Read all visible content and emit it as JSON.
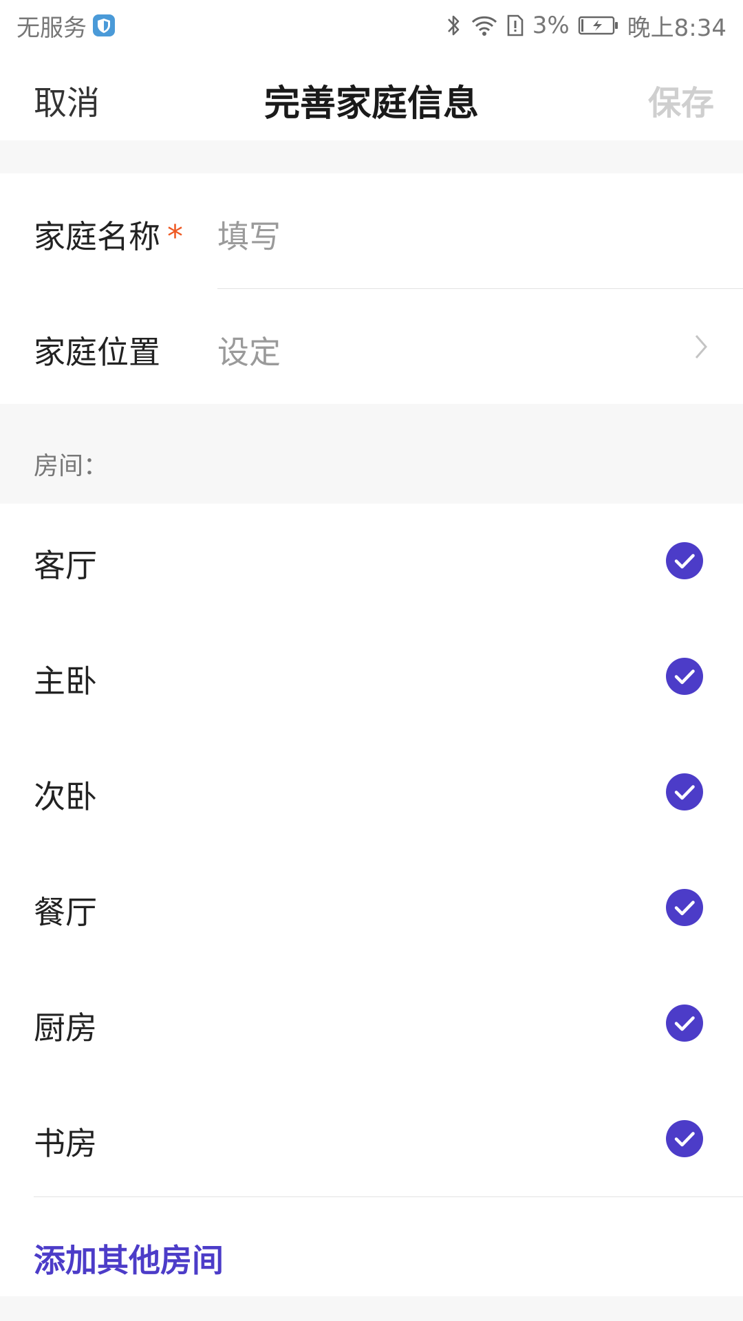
{
  "statusbar": {
    "carrier": "无服务",
    "battery_percent": "3%",
    "time": "晚上8:34"
  },
  "navbar": {
    "cancel": "取消",
    "title": "完善家庭信息",
    "save": "保存"
  },
  "form": {
    "name_label": "家庭名称",
    "required_mark": "*",
    "name_placeholder": "填写",
    "location_label": "家庭位置",
    "location_value": "设定"
  },
  "rooms": {
    "header": "房间：",
    "items": [
      {
        "label": "客厅",
        "checked": true
      },
      {
        "label": "主卧",
        "checked": true
      },
      {
        "label": "次卧",
        "checked": true
      },
      {
        "label": "餐厅",
        "checked": true
      },
      {
        "label": "厨房",
        "checked": true
      },
      {
        "label": "书房",
        "checked": true
      }
    ],
    "add_label": "添加其他房间"
  },
  "colors": {
    "accent": "#4c3cc8",
    "required": "#ee5a24",
    "placeholder": "#9a9a9a",
    "disabled": "#cfcfcf"
  }
}
